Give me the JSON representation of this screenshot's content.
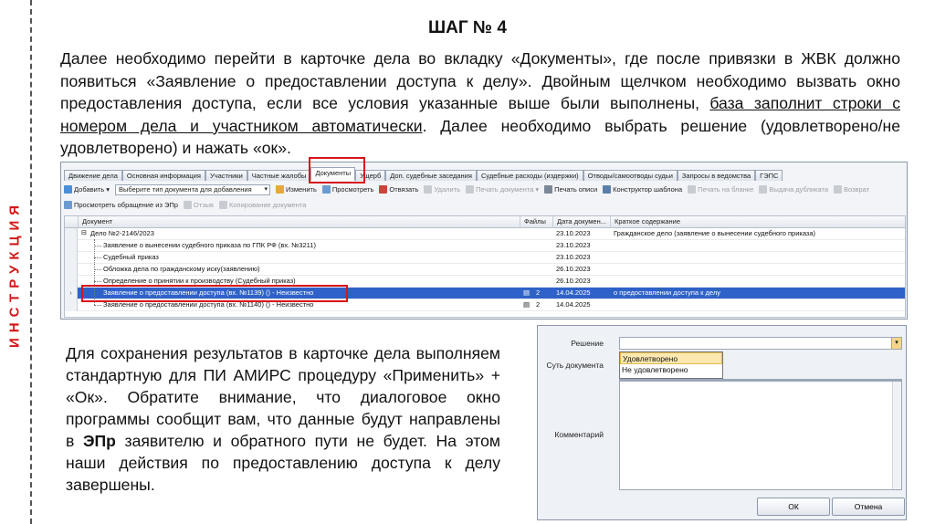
{
  "rail_label": "ИНСТРУКЦИЯ",
  "title": "ШАГ № 4",
  "para1": {
    "p1": "Далее необходимо перейти в карточке дела во вкладку «Документы», где после привязки в ЖВК должно появиться «Заявление о предоставлении доступа к делу». Двойным щелчком необходимо вызвать окно предоставления доступа, если все условия указанные выше были выполнены, ",
    "underlined": "база заполнит строки с номером дела и участником автоматически",
    "p2": ". Далее необходимо выбрать решение (удовлетворено/не удовлетворено) и нажать «ок»."
  },
  "tabs": [
    "Движение дела",
    "Основная информация",
    "Участники",
    "Частные жалобы",
    "Документы",
    "Ущерб",
    "Доп. судебные заседания",
    "Судебные расходы (издержки)",
    "Отводы/самоотводы судьи",
    "Запросы в ведомства",
    "ГЭПС"
  ],
  "toolbar1": {
    "add": "Добавить",
    "select_placeholder": "Выберите тип документа для добавления",
    "edit": "Изменить",
    "view": "Просмотреть",
    "unlink": "Отвязать",
    "delete": "Удалить",
    "print_doc": "Печать документа",
    "print_inv": "Печать описи",
    "template": "Конструктор шаблона",
    "print_blank": "Печать на бланке",
    "duplicate": "Выдача дубликата",
    "return": "Возврат"
  },
  "toolbar2": {
    "view_epr": "Просмотреть обращение из ЭПр",
    "recall": "Отзыв",
    "copy": "Копирование документа"
  },
  "grid": {
    "headers": {
      "doc": "Документ",
      "files": "Файлы",
      "date": "Дата докумен...",
      "summary": "Краткое содержание"
    },
    "rows": [
      {
        "doc": "Дело №2-2146/2023",
        "files": "",
        "date": "23.10.2023",
        "summary": "Гражданское дело (заявление о вынесении судебного приказа)"
      },
      {
        "doc": "Заявление о вынесении судебного приказа по ГПК РФ (вх. №3211)",
        "files": "",
        "date": "23.10.2023",
        "summary": ""
      },
      {
        "doc": "Судебный приказ",
        "files": "",
        "date": "23.10.2023",
        "summary": ""
      },
      {
        "doc": "Обложка дела по гражданскому иску(заявлению)",
        "files": "",
        "date": "26.10.2023",
        "summary": ""
      },
      {
        "doc": "Определение о принятии к производству (Судебный приказ)",
        "files": "",
        "date": "26.10.2023",
        "summary": ""
      },
      {
        "doc": "Заявление о предоставлении доступа (вх. №1139) () - Неизвестно",
        "files": "2",
        "date": "14.04.2025",
        "summary": "о предоставлении доступа к делу"
      },
      {
        "doc": "Заявление о предоставлении доступа (вх. №1140) () - Неизвестно",
        "files": "2",
        "date": "14.04.2025",
        "summary": ""
      }
    ]
  },
  "para2": {
    "p1": "Для сохранения результатов в карточке дела выполняем стандартную для ПИ АМИРС процедуру «Применить» + «Ок». Обратите внимание, что диалоговое окно программы сообщит вам, что данные будут направлены в ",
    "bold": "ЭПр",
    "p2": " заявителю и обратного пути не будет. На этом наши действия по предоставлению доступа к делу завершены."
  },
  "dialog": {
    "decision_label": "Решение",
    "essence_label": "Суть документа",
    "comment_label": "Комментарий",
    "options": [
      "Удовлетворено",
      "Не удовлетворено"
    ],
    "ok": "ОК",
    "cancel": "Отмена"
  },
  "colors": {
    "accent_red": "#d8151b",
    "selection_blue": "#2f62c8",
    "dropdown_hover": "#fde9b0"
  }
}
